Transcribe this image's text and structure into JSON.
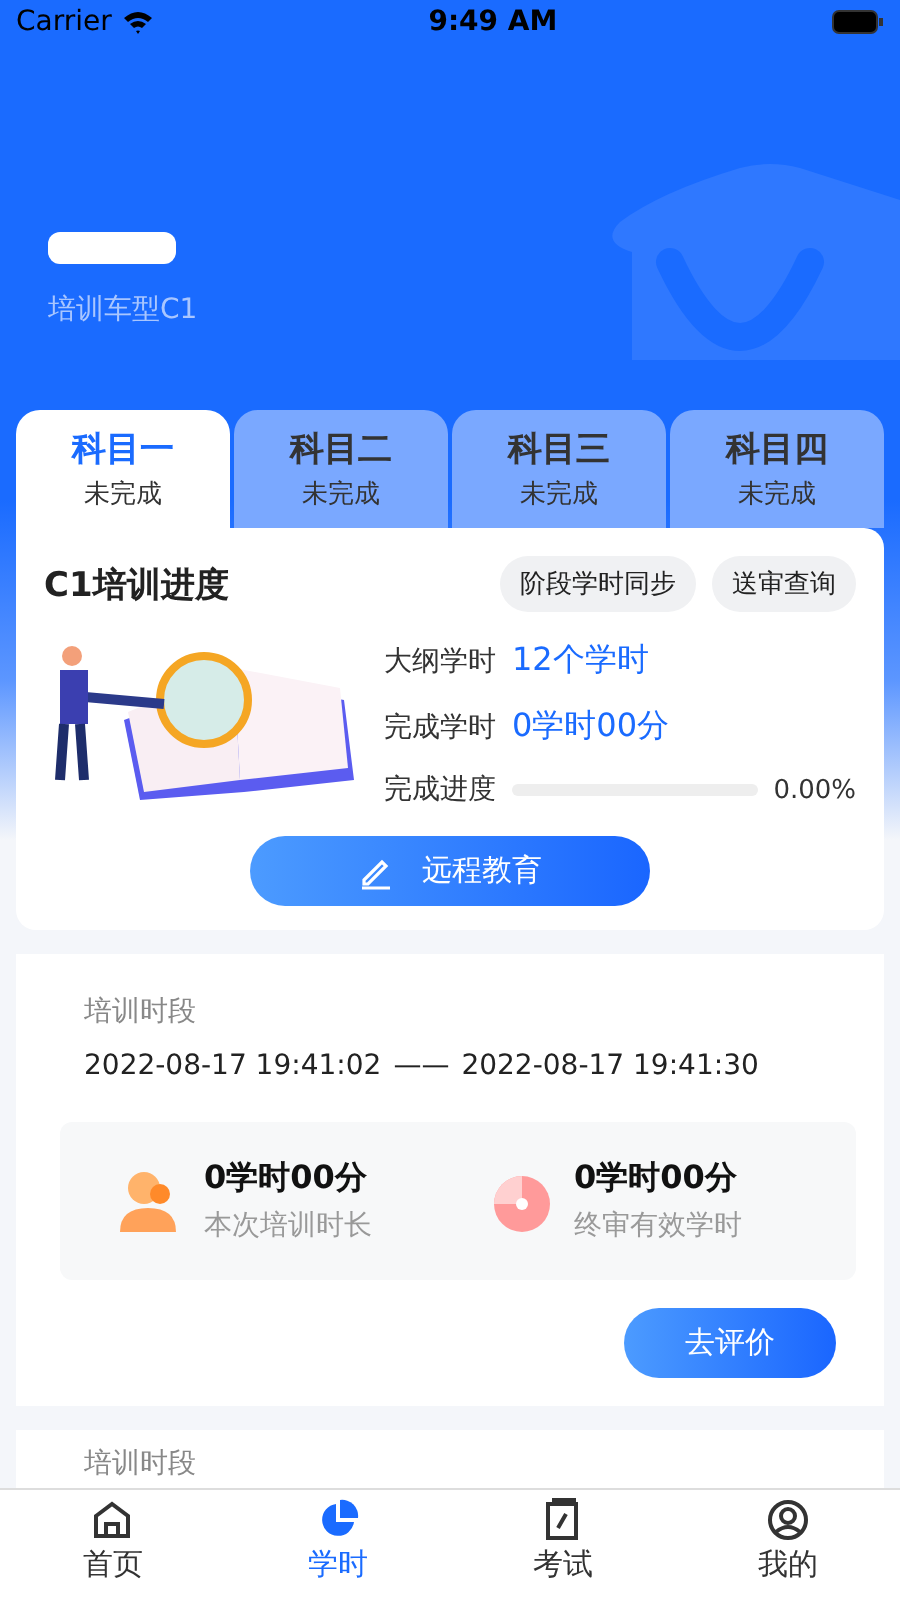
{
  "status_bar": {
    "carrier": "Carrier",
    "time": "9:49 AM"
  },
  "header": {
    "vehicle_type": "培训车型C1"
  },
  "subjects": [
    {
      "name": "科目一",
      "status": "未完成",
      "selected": true
    },
    {
      "name": "科目二",
      "status": "未完成",
      "selected": false
    },
    {
      "name": "科目三",
      "status": "未完成",
      "selected": false
    },
    {
      "name": "科目四",
      "status": "未完成",
      "selected": false
    }
  ],
  "progress_card": {
    "title": "C1培训进度",
    "actions": [
      "阶段学时同步",
      "送审查询"
    ],
    "stats": [
      {
        "label": "大纲学时",
        "value": "12个学时"
      },
      {
        "label": "完成学时",
        "value": "0学时00分"
      }
    ],
    "progress": {
      "label": "完成进度",
      "level": 0,
      "reading": "0.00%"
    },
    "button": "远程教育"
  },
  "sessions": [
    {
      "label": "培训时段",
      "start": "2022-08-17 19:41:02",
      "separator": "——",
      "end": "2022-08-17 19:41:30",
      "metrics": [
        {
          "kind": "person",
          "value": "0学时00分",
          "label": "本次培训时长"
        },
        {
          "kind": "dial",
          "value": "0学时00分",
          "label": "终审有效学时"
        }
      ],
      "button": "去评价"
    },
    {
      "label": "培训时段"
    }
  ],
  "tab_bar": [
    {
      "kind": "home",
      "label": "首页",
      "selected": false
    },
    {
      "kind": "chart",
      "label": "学时",
      "selected": true
    },
    {
      "kind": "exam",
      "label": "考试",
      "selected": false
    },
    {
      "kind": "profile",
      "label": "我的",
      "selected": false
    }
  ]
}
